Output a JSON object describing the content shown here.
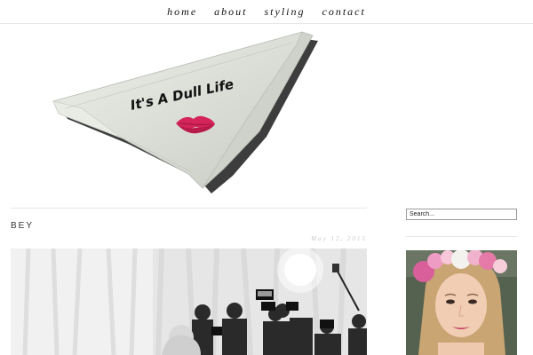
{
  "nav": {
    "items": [
      {
        "label": "home"
      },
      {
        "label": "about"
      },
      {
        "label": "styling"
      },
      {
        "label": "contact"
      }
    ]
  },
  "header": {
    "logo_text": "It's A Dull Life",
    "icon": "lipstick-kiss-icon"
  },
  "post": {
    "title": "BEY",
    "date": "May 12, 2015"
  },
  "sidebar": {
    "search_placeholder": "Search..."
  },
  "colors": {
    "napkin": "#dfe1db",
    "kiss": "#d4245a",
    "rule": "#e8e8e8"
  }
}
